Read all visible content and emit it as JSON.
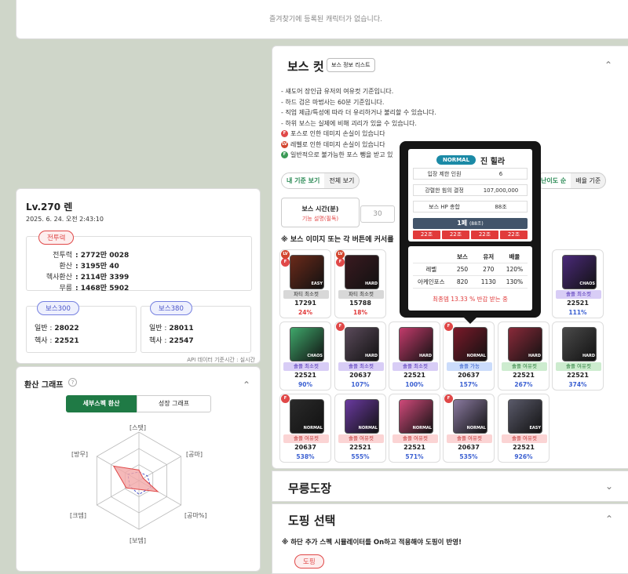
{
  "favorites": {
    "empty_text": "즐겨찾기에 등록된 캐릭터가 없습니다."
  },
  "boss": {
    "title": "보스 컷",
    "info_button": "보스 정보 리스트",
    "notes": [
      "- 섀도어 장인급 유저의 여유컷 기준입니다.",
      "- 하드 검은 마법사는 60분 기준입니다.",
      "- 직업 제급/특성에 따라 더 유리하거나 불리할 수 있습니다.",
      "- 하위 보스는 실제에 비해 괴리가 있을 수 있습니다."
    ],
    "badge_notes": [
      {
        "badge": "F",
        "text": "포스로 인한 데미지 손실이 있습니다"
      },
      {
        "badge": "LV",
        "text": "레벨로 인한 데미지 손실이 있습니다"
      },
      {
        "badge": "F",
        "text": "일반적으로 불가능한 포스 뺑을 받고 있"
      }
    ],
    "view_toggle": [
      "내 기준 보기",
      "전체 보기"
    ],
    "sort_toggle": [
      "난이도 순",
      "배율 기준"
    ],
    "time_label": "보스 시간(분)",
    "time_sub": "기능 설명(필독)",
    "time_value": "30",
    "tip": "※ 보스 이미지 또는 각 버튼에 커서를",
    "cards": [
      {
        "diff": "EASY",
        "label": "파티 최소컷",
        "style": "grey",
        "num": "17291",
        "pct": "24%",
        "pc": "red",
        "badges": [
          "LV",
          "F"
        ],
        "color": "#6b2a1a"
      },
      {
        "diff": "HARD",
        "label": "파티 최소컷",
        "style": "grey",
        "num": "15788",
        "pct": "18%",
        "pc": "red",
        "badges": [
          "LV",
          "F"
        ],
        "color": "#3a1a20"
      },
      {
        "diff": "CHAOS",
        "label": "솔플 최소컷",
        "style": "purple",
        "num": "22521",
        "pct": "111%",
        "pc": "blue",
        "badges": [],
        "color": "#4b2a7a"
      },
      {
        "diff": "CHAOS",
        "label": "솔플 최소컷",
        "style": "purple",
        "num": "22521",
        "pct": "90%",
        "pc": "blue",
        "badges": [],
        "color": "#3fa86b"
      },
      {
        "diff": "HARD",
        "label": "솔플 최소컷",
        "style": "purple",
        "num": "20637",
        "pct": "107%",
        "pc": "blue",
        "badges": [
          "F"
        ],
        "color": "#5a4a5a"
      },
      {
        "diff": "HARD",
        "label": "솔플 최소컷",
        "style": "purple",
        "num": "22521",
        "pct": "100%",
        "pc": "blue",
        "badges": [],
        "color": "#c23b6b"
      },
      {
        "diff": "NORMAL",
        "label": "솔플 가능",
        "style": "blue",
        "num": "20637",
        "pct": "157%",
        "pc": "blue",
        "badges": [
          "F"
        ],
        "color": "#7a1a2a"
      },
      {
        "diff": "HARD",
        "label": "솔플 여유컷",
        "style": "green",
        "num": "22521",
        "pct": "267%",
        "pc": "blue",
        "badges": [],
        "color": "#8a2a3a"
      },
      {
        "diff": "HARD",
        "label": "솔플 여유컷",
        "style": "green",
        "num": "22521",
        "pct": "374%",
        "pc": "blue",
        "badges": [],
        "color": "#4a4a4a"
      },
      {
        "diff": "NORMAL",
        "label": "솔플 여유컷",
        "style": "pink",
        "num": "20637",
        "pct": "538%",
        "pc": "blue",
        "badges": [
          "F"
        ],
        "color": "#2a2a2a"
      },
      {
        "diff": "NORMAL",
        "label": "솔플 여유컷",
        "style": "pink",
        "num": "22521",
        "pct": "555%",
        "pc": "blue",
        "badges": [],
        "color": "#6a3aa0"
      },
      {
        "diff": "NORMAL",
        "label": "솔플 여유컷",
        "style": "pink",
        "num": "22521",
        "pct": "571%",
        "pc": "blue",
        "badges": [],
        "color": "#d04a7a"
      },
      {
        "diff": "NORMAL",
        "label": "솔플 여유컷",
        "style": "pink",
        "num": "20637",
        "pct": "535%",
        "pc": "blue",
        "badges": [
          "F"
        ],
        "color": "#8a7aa0"
      },
      {
        "diff": "EASY",
        "label": "솔플 여유컷",
        "style": "pink",
        "num": "22521",
        "pct": "926%",
        "pc": "blue",
        "badges": [],
        "color": "#5a5a6a"
      },
      {
        "diff": "CHAOS",
        "label": "솔플 최소컷",
        "style": "purple",
        "num": "22521",
        "pct": "111%",
        "pc": "blue",
        "badges": [],
        "color": "#4b2a7a"
      }
    ]
  },
  "tooltip": {
    "difficulty": "NORMAL",
    "name": "진 힐라",
    "rows": [
      {
        "k": "입장 제한 인원",
        "v": "6"
      },
      {
        "k": "강렬한 힘의 결정",
        "v": "107,000,000"
      },
      {
        "k": "보스 HP 총합",
        "v": "88조"
      }
    ],
    "phase": "1페",
    "phase_hp": "(88조)",
    "phase_cells": [
      "22조",
      "22조",
      "22조",
      "22조"
    ],
    "table_head": [
      "",
      "보스",
      "유저",
      "배율"
    ],
    "table_rows": [
      [
        "레벨",
        "250",
        "270",
        "120%"
      ],
      [
        "아케인포스",
        "820",
        "1130",
        "130%"
      ]
    ],
    "final_note": "최종뎀 13.33 % 반감 받는 중"
  },
  "sections": {
    "mureung": "무릉도장",
    "doping": "도핑 선택",
    "doping_note": "※ 하단 추가 스펙 시뮬레이터를 On하고 적용해야 도핑이 반영!",
    "doping_tag": "도핑"
  },
  "character": {
    "name": "Lv.270 렌",
    "date": "2025. 6. 24. 오전 2:43:10",
    "combat_tag": "전투력",
    "stats": [
      {
        "k": "전투력",
        "v": ": 2772만 0028"
      },
      {
        "k": "환산",
        "v": ": 3195만 40"
      },
      {
        "k": "헥사환산",
        "v": ": 2114만 3399"
      },
      {
        "k": "무릉",
        "v": ": 1468만 5902"
      }
    ],
    "boss300": {
      "tag": "보스300",
      "normal": "일반 : ",
      "normal_v": "28022",
      "hexa": "헥사 : ",
      "hexa_v": "22521"
    },
    "boss380": {
      "tag": "보스380",
      "normal": "일반 : ",
      "normal_v": "28011",
      "hexa": "헥사 : ",
      "hexa_v": "22547"
    },
    "footer": "API 데이터 기준시간 : 실시간"
  },
  "graph": {
    "title": "환산 그래프",
    "tab_active": "세부스펙 환산",
    "tab_other": "성장 그래프",
    "axes": [
      "[스탯]",
      "[공마]",
      "[공마%]",
      "[보뎀]",
      "[크뎀]",
      "[방무]"
    ],
    "colors": {
      "fill": "#f3a7a7",
      "stroke": "#e04848",
      "dash": "#4b55c9"
    }
  }
}
